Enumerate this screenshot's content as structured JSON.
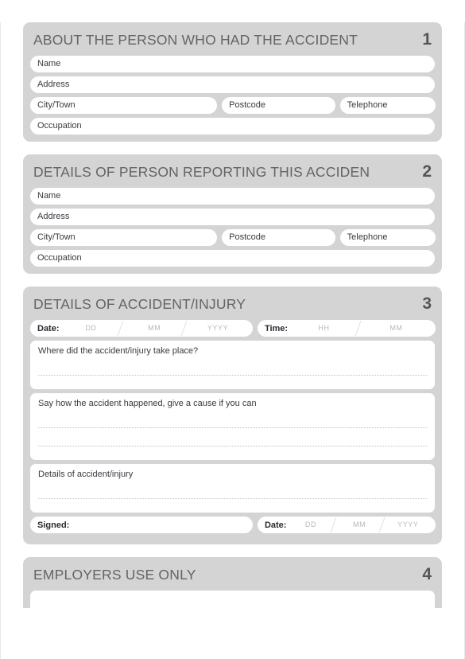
{
  "form": {
    "sections": [
      {
        "number": "1",
        "title": "ABOUT THE PERSON WHO HAD THE ACCIDENT",
        "fields": {
          "name": "Name",
          "address": "Address",
          "city": "City/Town",
          "postcode": "Postcode",
          "telephone": "Telephone",
          "occupation": "Occupation"
        }
      },
      {
        "number": "2",
        "title": "DETAILS OF PERSON REPORTING THIS ACCIDEN",
        "fields": {
          "name": "Name",
          "address": "Address",
          "city": "City/Town",
          "postcode": "Postcode",
          "telephone": "Telephone",
          "occupation": "Occupation"
        }
      },
      {
        "number": "3",
        "title": "DETAILS OF ACCIDENT/INJURY",
        "date_label": "Date:",
        "date_dd": "DD",
        "date_mm": "MM",
        "date_yyyy": "YYYY",
        "time_label": "Time:",
        "time_hh": "HH",
        "time_mm": "MM",
        "q_where": "Where did the accident/injury take place?",
        "q_how": "Say how the accident happened, give a cause if you can",
        "q_details": "Details of accident/injury",
        "signed_label": "Signed:",
        "signed_date_label": "Date:",
        "signed_dd": "DD",
        "signed_mm": "MM",
        "signed_yyyy": "YYYY"
      },
      {
        "number": "4",
        "title": "EMPLOYERS USE ONLY"
      }
    ]
  }
}
